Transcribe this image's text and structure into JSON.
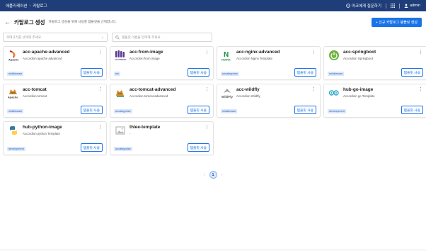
{
  "topbar": {
    "breadcrumb": [
      "애플리케이션",
      "카탈로그"
    ],
    "ask_ai": "아코에게 질문하기",
    "user": "admin",
    "colors": {
      "background": "#1f3d78"
    }
  },
  "header": {
    "title": "카탈로그 생성",
    "subtitle": "카탈로그 생성을 위해 사용할 템플릿을 선택합니다.",
    "new_button": "+ 신규 카탈로그 템플릿 생성"
  },
  "filters": {
    "category_placeholder": "카테고리를 선택해 주세요.",
    "search_placeholder": "템플릿 이름을 입력해 주세요."
  },
  "use_label": "템플릿 사용",
  "templates": [
    {
      "name": "acc-apache-advanced",
      "desc": "Accordion apache advanced",
      "tag": "middleware",
      "logo": "apache-logo-icon"
    },
    {
      "name": "acc-from-image",
      "desc": "Accordion from image",
      "tag": "etc",
      "logo": "accordion-logo-icon"
    },
    {
      "name": "acc-nginx-advanced",
      "desc": "Accordion Nginx Template",
      "tag": "uncategorize",
      "logo": "nginx-logo-icon"
    },
    {
      "name": "acc-springboot",
      "desc": "Accordion Springboot",
      "tag": "middleware",
      "logo": "springboot-logo-icon"
    },
    {
      "name": "acc-tomcat",
      "desc": "Accordion tomcat",
      "tag": "middleware",
      "logo": "tomcat-logo-icon"
    },
    {
      "name": "acc-tomcat-advanced",
      "desc": "Accordion tomcat advanced",
      "tag": "uncategorize",
      "logo": "tomcat-logo-icon"
    },
    {
      "name": "acc-wildfly",
      "desc": "Accordion Wildfly",
      "tag": "middleware",
      "logo": "wildfly-logo-icon"
    },
    {
      "name": "hub-go-image",
      "desc": "Accordion go Template",
      "tag": "development",
      "logo": "go-logo-icon"
    },
    {
      "name": "hub-python-image",
      "desc": "Accordion python Template",
      "tag": "development",
      "logo": "python-logo-icon"
    },
    {
      "name": "thlee-template",
      "desc": "-",
      "tag": "uncategorize",
      "logo": "image-placeholder-icon"
    }
  ],
  "pagination": {
    "current": "1"
  }
}
